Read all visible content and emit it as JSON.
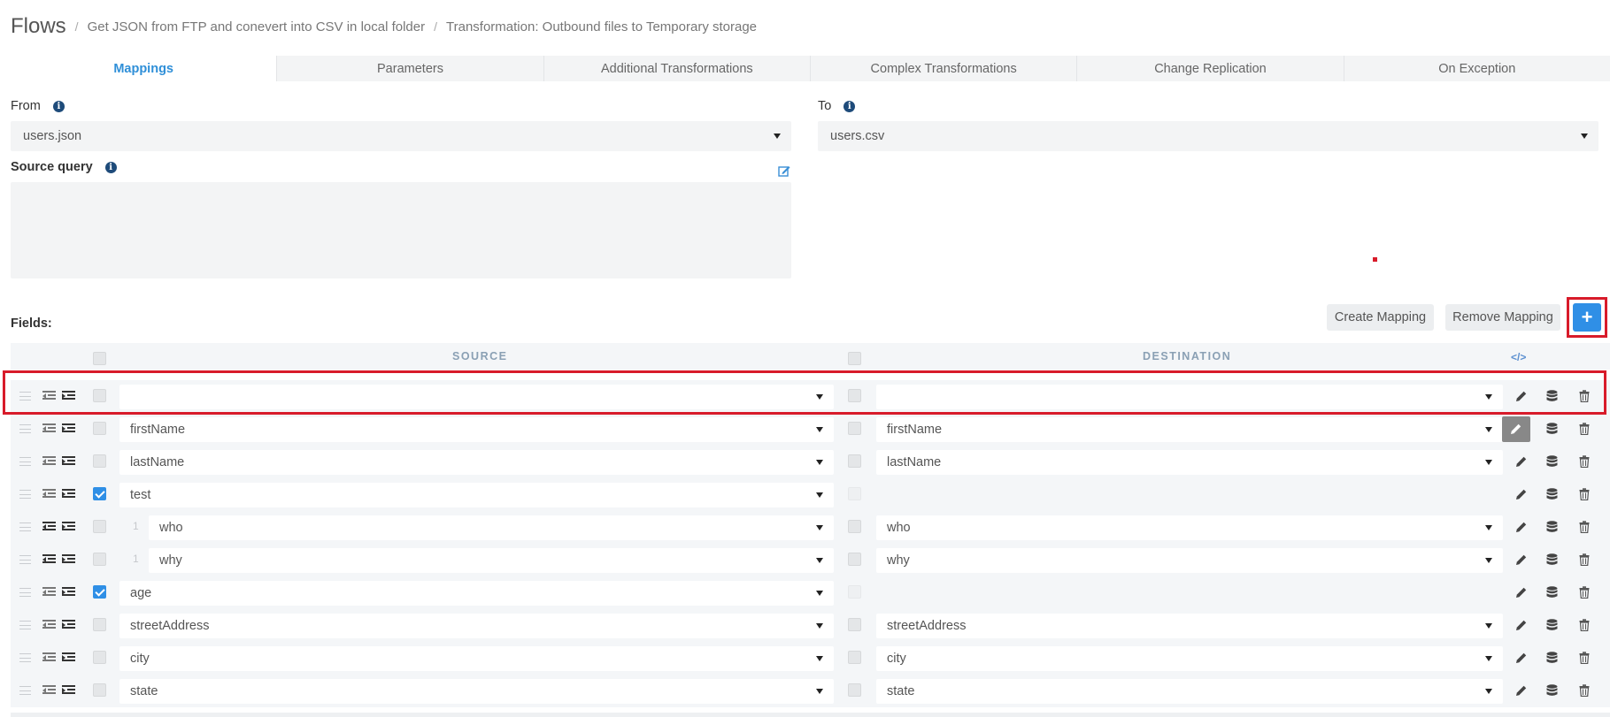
{
  "breadcrumb": {
    "root": "Flows",
    "items": [
      "Get JSON from FTP and conevert into CSV in local folder",
      "Transformation: Outbound files to Temporary storage"
    ]
  },
  "tabs": [
    {
      "label": "Mappings",
      "active": true
    },
    {
      "label": "Parameters",
      "active": false
    },
    {
      "label": "Additional Transformations",
      "active": false
    },
    {
      "label": "Complex Transformations",
      "active": false
    },
    {
      "label": "Change Replication",
      "active": false
    },
    {
      "label": "On Exception",
      "active": false
    }
  ],
  "from": {
    "label": "From",
    "value": "users.json"
  },
  "to": {
    "label": "To",
    "value": "users.csv"
  },
  "source_query": {
    "label": "Source query",
    "value": ""
  },
  "fields": {
    "label": "Fields:",
    "create_mapping": "Create Mapping",
    "remove_mapping": "Remove Mapping",
    "add_button": "+"
  },
  "grid": {
    "source_header": "SOURCE",
    "destination_header": "DESTINATION",
    "code_icon_glyph": "</>",
    "rows": [
      {
        "source": "",
        "destination": "",
        "checked": false,
        "level": "",
        "has_destination": true,
        "outdent_dark": false,
        "edit_boxed": false
      },
      {
        "source": "firstName",
        "destination": "firstName",
        "checked": false,
        "level": "",
        "has_destination": true,
        "outdent_dark": false,
        "edit_boxed": true
      },
      {
        "source": "lastName",
        "destination": "lastName",
        "checked": false,
        "level": "",
        "has_destination": true,
        "outdent_dark": false,
        "edit_boxed": false
      },
      {
        "source": "test",
        "destination": "",
        "checked": true,
        "level": "",
        "has_destination": false,
        "outdent_dark": false,
        "edit_boxed": false
      },
      {
        "source": "who",
        "destination": "who",
        "checked": false,
        "level": "1",
        "has_destination": true,
        "outdent_dark": true,
        "edit_boxed": false
      },
      {
        "source": "why",
        "destination": "why",
        "checked": false,
        "level": "1",
        "has_destination": true,
        "outdent_dark": true,
        "edit_boxed": false
      },
      {
        "source": "age",
        "destination": "",
        "checked": true,
        "level": "",
        "has_destination": false,
        "outdent_dark": false,
        "edit_boxed": false
      },
      {
        "source": "streetAddress",
        "destination": "streetAddress",
        "checked": false,
        "level": "",
        "has_destination": true,
        "outdent_dark": false,
        "edit_boxed": false
      },
      {
        "source": "city",
        "destination": "city",
        "checked": false,
        "level": "",
        "has_destination": true,
        "outdent_dark": false,
        "edit_boxed": false
      },
      {
        "source": "state",
        "destination": "state",
        "checked": false,
        "level": "",
        "has_destination": true,
        "outdent_dark": false,
        "edit_boxed": false
      }
    ]
  },
  "colors": {
    "accent": "#2f8fe6",
    "highlight": "#d81b2a",
    "info": "#1e4b7a"
  }
}
